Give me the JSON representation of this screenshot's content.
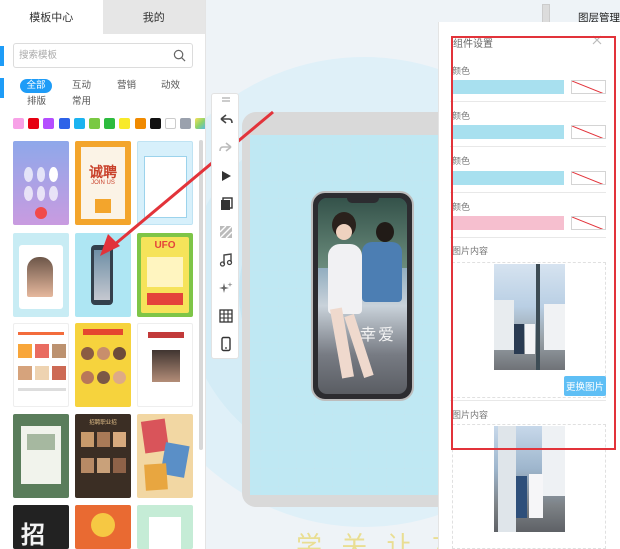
{
  "left_panel": {
    "tabs": [
      "模板中心",
      "我的"
    ],
    "search_placeholder": "搜索模板",
    "categories": [
      "全部",
      "互动",
      "营销",
      "动效",
      "排版",
      "常用"
    ],
    "swatches": [
      "#f7a1e7",
      "#e60012",
      "#b44dff",
      "#2d62e8",
      "#1bb3f0",
      "#7ac943",
      "#2dbb3f",
      "#f8ea2a",
      "#f08a00",
      "#111111",
      "#ffffff",
      "#9aa1ad",
      "multi"
    ],
    "thumbnail_texts": {
      "t2_title": "诚聘",
      "t2_sub": "JOIN US",
      "t6_title": "UFO",
      "t8_title": "招",
      "t7_title": "招聘职业招"
    }
  },
  "top_bar": {
    "layer_manager": "图层管理"
  },
  "right_panel": {
    "title": "组件设置",
    "color_label": "颜色",
    "colors": [
      "#a8e0ef",
      "#a8e0ef",
      "#a8e0ef",
      "#f6bfcf"
    ],
    "image_label": "图片内容",
    "replace_button": "更换图片"
  },
  "canvas": {
    "phone_overlay_text": "幸爱",
    "bottom_watermark": "学  关  让  友  作  网"
  },
  "icons": [
    "search-icon",
    "drag-handle-icon",
    "undo-icon",
    "redo-icon",
    "play-icon",
    "copy-icon",
    "texture-icon",
    "music-icon",
    "sparkle-icon",
    "grid-icon",
    "phone-icon",
    "close-icon"
  ]
}
